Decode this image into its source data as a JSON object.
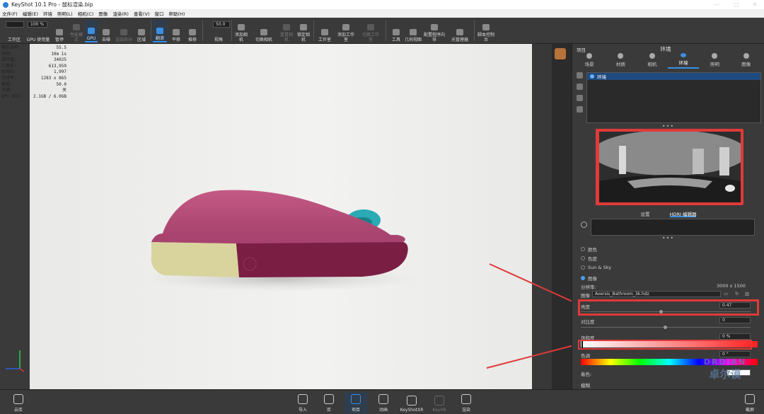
{
  "app": {
    "title": "KeyShot 10.1 Pro - 鼠标渲染.bip"
  },
  "window_controls": [
    "—",
    "▢",
    "✕"
  ],
  "menu": [
    "文件(F)",
    "编辑(E)",
    "环境",
    "照明(L)",
    "相机(C)",
    "图像",
    "渲染(R)",
    "查看(V)",
    "窗口",
    "帮助(H)"
  ],
  "toolbar": {
    "zoom_value": "100 %",
    "fov_value": "50.0",
    "items": [
      "工作区",
      "GPU 使用量",
      "暂停",
      "性能模式",
      "GPU",
      "去噪",
      "渲染拆分",
      "区域",
      "翻滚",
      "平移",
      "推移",
      "视角",
      "添加相机",
      "切换相机",
      "重置相机",
      "锁定相机",
      "工作室",
      "添加工作室",
      "切换工作室",
      "工具",
      "几何视图",
      "配置程序向导",
      "光管理器",
      "脚本控制台"
    ]
  },
  "stats": [
    {
      "label": "每秒采样:",
      "value": "55.5"
    },
    {
      "label": "时间:",
      "value": "10m 1s"
    },
    {
      "label": "采样值:",
      "value": "34025"
    },
    {
      "label": "三角形:",
      "value": "613,959"
    },
    {
      "label": "NURBS:",
      "value": "1,997"
    },
    {
      "label": "分辨率:",
      "value": "1283 x 865"
    },
    {
      "label": "焦距:",
      "value": "50.0"
    },
    {
      "label": "去噪:",
      "value": "关"
    },
    {
      "label": "GPU 内存:",
      "value": "2.1GB / 6.0GB"
    }
  ],
  "panel": {
    "header_left": "项目",
    "header_title": "环境",
    "tabs": [
      "场景",
      "材质",
      "相机",
      "环境",
      "照明",
      "图像"
    ],
    "env_item": "环境",
    "subtabs": [
      "设置",
      "HDRI 编辑器"
    ],
    "bg_options": [
      "颜色",
      "色度",
      "Sun & Sky",
      "图像"
    ],
    "resolution_label": "分辨率:",
    "resolution_value": "3000 x 1500",
    "image_label": "图像",
    "image_file": "Aversis_Bathroom_3k.hdz",
    "brightness_label": "亮度",
    "brightness_value": "0.47",
    "brightness": 0.47,
    "contrast_label": "对比度",
    "contrast_value": "0",
    "saturation_label": "饱和度",
    "saturation_value": "0 %",
    "hue_label": "色调",
    "hue_value": "0 °",
    "tint_label": "着色:",
    "blur_label": "模糊"
  },
  "bottom": {
    "items": [
      "导入",
      "库",
      "项目",
      "动画",
      "KeyShotXR",
      "KeyVR",
      "渲染"
    ],
    "cloud": "云库",
    "screenshot": "截屏"
  },
  "watermark": {
    "line1": "DRDIAN",
    "line2": "卓尔谟"
  },
  "colors": {
    "accent": "#3b8fe0",
    "highlight_box": "#e03a3a",
    "mouse_body": "#b0466e",
    "mouse_base": "#d8d39a"
  }
}
